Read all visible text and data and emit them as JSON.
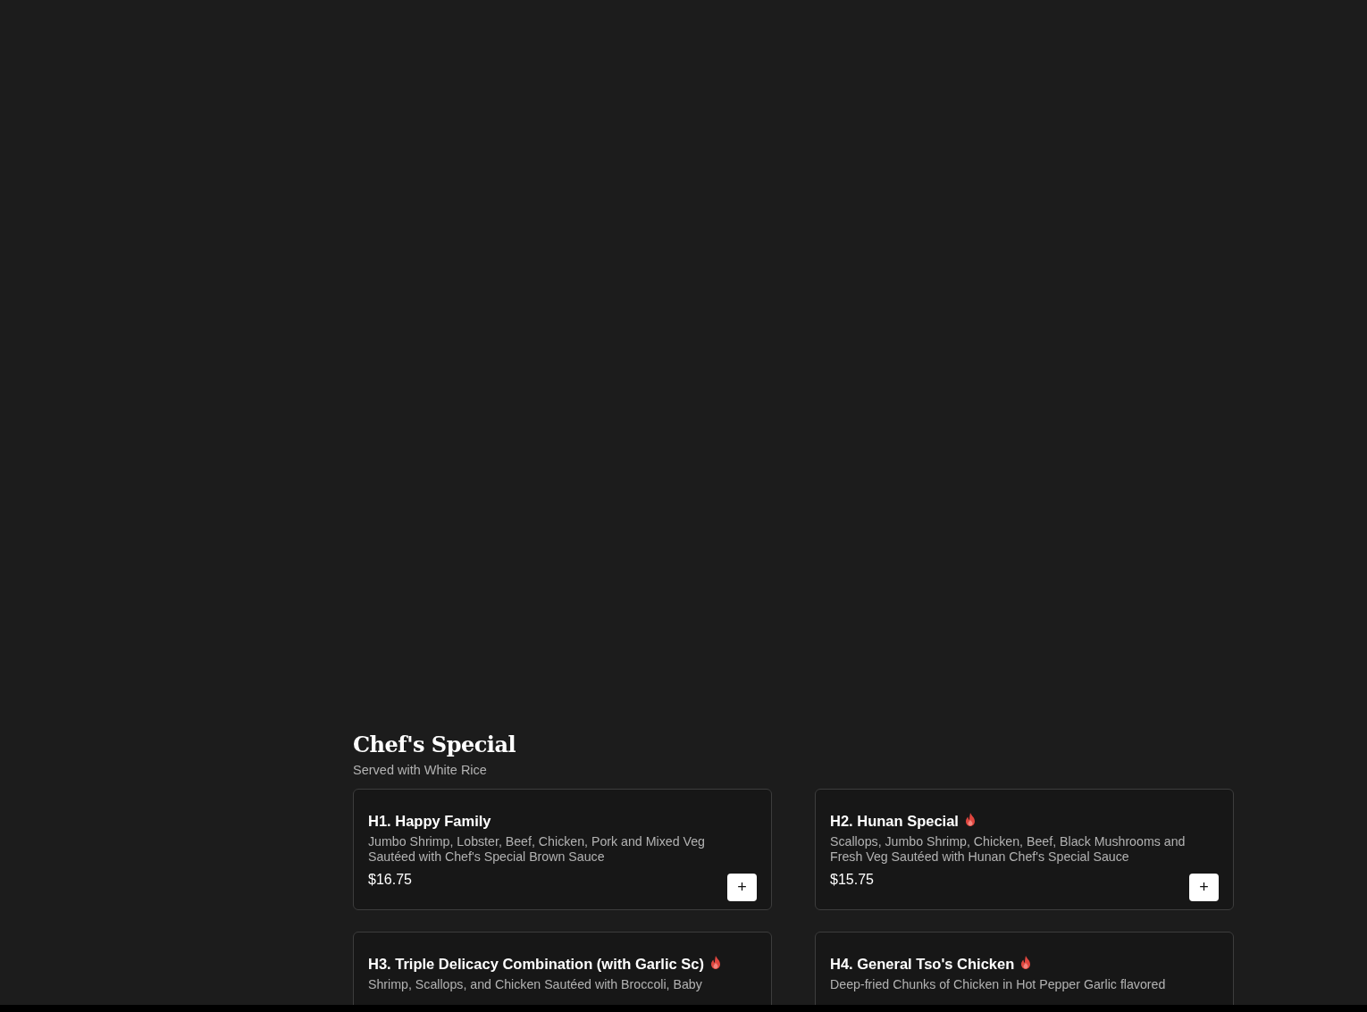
{
  "section": {
    "title": "Chef's Special",
    "subtitle": "Served with White Rice"
  },
  "items": [
    {
      "name": "H1. Happy Family",
      "spicy": false,
      "description": "Jumbo Shrimp, Lobster, Beef, Chicken, Pork and Mixed Veg Sautéed with Chef's Special Brown Sauce",
      "price": "$16.75",
      "add": "+"
    },
    {
      "name": "H2. Hunan Special",
      "spicy": true,
      "description": "Scallops, Jumbo Shrimp, Chicken, Beef, Black Mushrooms and Fresh Veg Sautéed with Hunan Chef's Special Sauce",
      "price": "$15.75",
      "add": "+"
    },
    {
      "name": "H3. Triple Delicacy Combination (with Garlic Sc)",
      "spicy": true,
      "description": "Shrimp, Scallops, and Chicken Sautéed with Broccoli, Baby"
    },
    {
      "name": "H4. General Tso's Chicken",
      "spicy": true,
      "description": "Deep-fried Chunks of Chicken in Hot Pepper Garlic flavored"
    }
  ]
}
